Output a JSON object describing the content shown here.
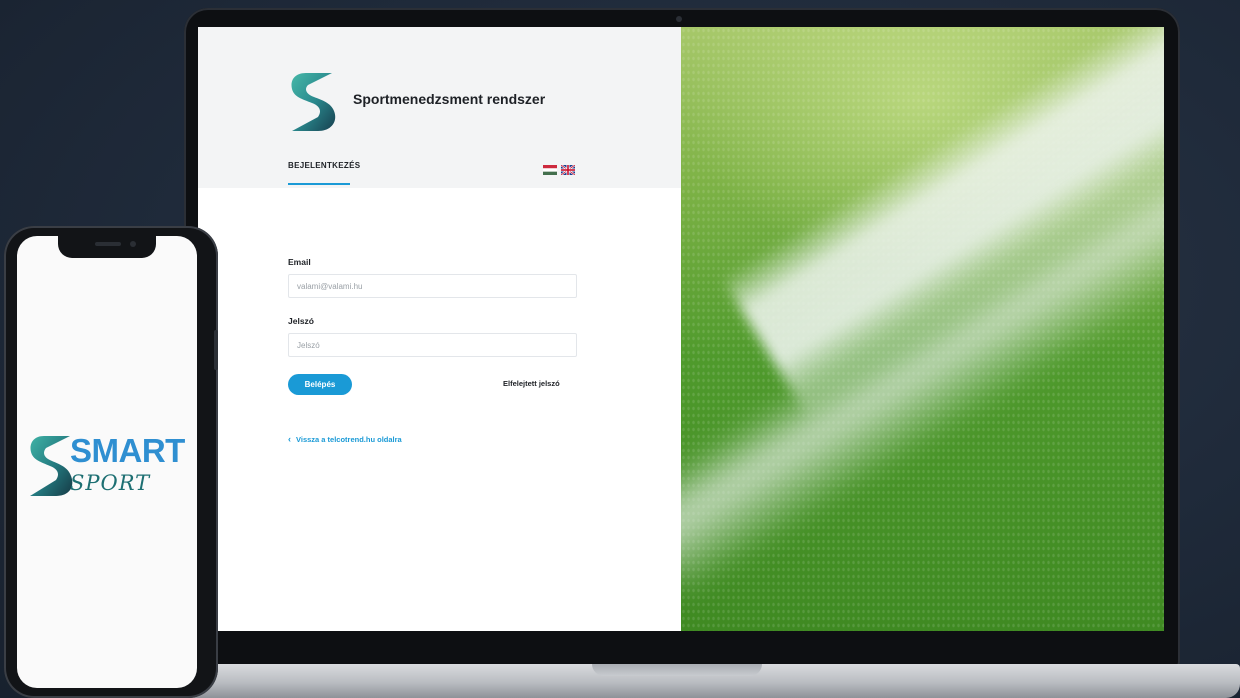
{
  "app": {
    "title": "Sportmenedzsment rendszer"
  },
  "tabs": {
    "login_label": "BEJELENTKEZÉS"
  },
  "languages": {
    "hu_icon": "flag-hu-icon",
    "en_icon": "flag-gb-icon"
  },
  "form": {
    "email_label": "Email",
    "email_placeholder": "valami@valami.hu",
    "password_label": "Jelszó",
    "password_placeholder": "Jelszó",
    "submit_label": "Belépés",
    "forgot_label": "Elfelejtett jelszó",
    "back_label": "Vissza a telcotrend.hu oldalra"
  },
  "phone": {
    "brand_top": "SMART",
    "brand_bottom": "SPORT"
  },
  "colors": {
    "accent": "#1a9ad6",
    "logo_dark": "#1d5c63",
    "logo_light": "#36a6a0"
  }
}
